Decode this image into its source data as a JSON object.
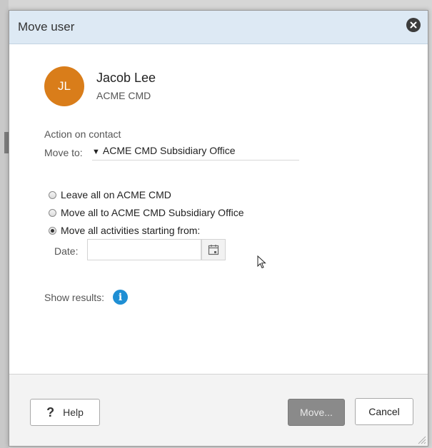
{
  "dialog": {
    "title": "Move user"
  },
  "user": {
    "initials": "JL",
    "name": "Jacob Lee",
    "company": "ACME CMD",
    "avatar_color": "#d97d1a"
  },
  "action": {
    "label": "Action on contact",
    "move_to_label": "Move to:",
    "move_to_value": "ACME CMD Subsidiary Office"
  },
  "options": [
    {
      "label": "Leave all on ACME CMD",
      "checked": false
    },
    {
      "label": "Move all to ACME CMD Subsidiary Office",
      "checked": false
    },
    {
      "label": "Move all activities starting from:",
      "checked": true
    }
  ],
  "date": {
    "label": "Date:",
    "value": ""
  },
  "results": {
    "label": "Show results:",
    "icon": "info-icon"
  },
  "footer": {
    "help_label": "Help",
    "move_label": "Move...",
    "cancel_label": "Cancel"
  },
  "colors": {
    "titlebar": "#dde9f4",
    "info": "#1f8fd4",
    "move_disabled": "#8a8a8a"
  }
}
